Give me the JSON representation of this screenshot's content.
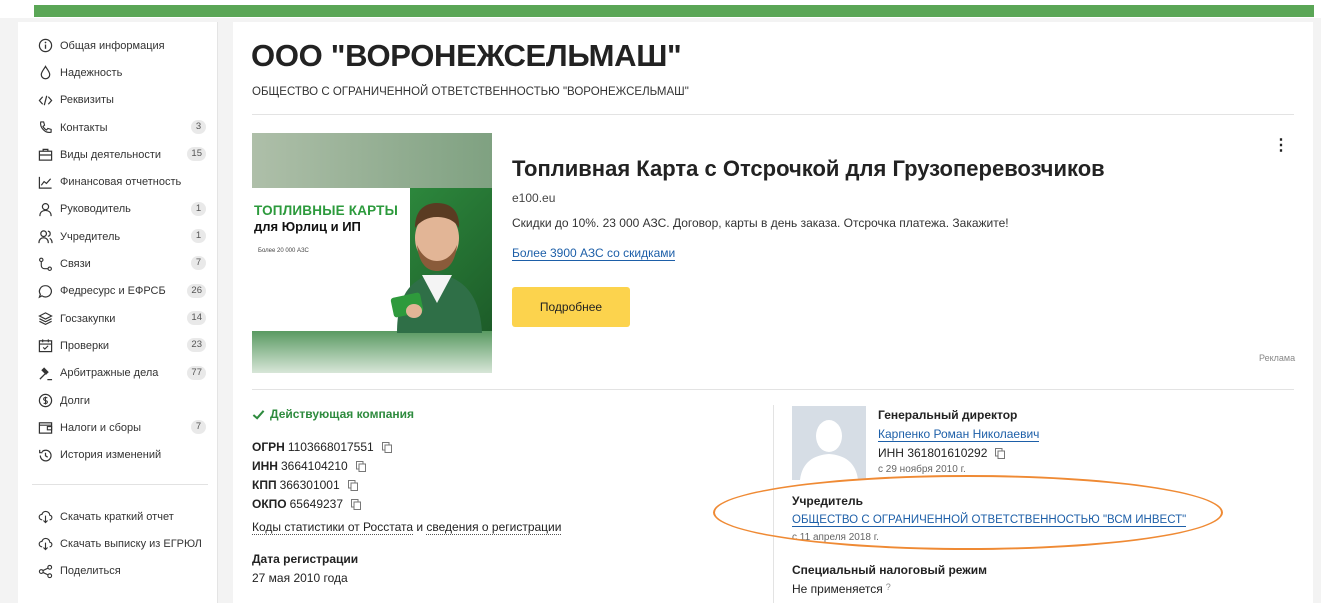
{
  "sidebar": {
    "items": [
      {
        "label": "Общая информация",
        "icon": "info-icon",
        "badge": ""
      },
      {
        "label": "Надежность",
        "icon": "drop-icon",
        "badge": ""
      },
      {
        "label": "Реквизиты",
        "icon": "code-icon",
        "badge": ""
      },
      {
        "label": "Контакты",
        "icon": "phone-icon",
        "badge": "3"
      },
      {
        "label": "Виды деятельности",
        "icon": "briefcase-icon",
        "badge": "15"
      },
      {
        "label": "Финансовая отчетность",
        "icon": "chart-icon",
        "badge": ""
      },
      {
        "label": "Руководитель",
        "icon": "person-icon",
        "badge": "1"
      },
      {
        "label": "Учредитель",
        "icon": "people-icon",
        "badge": "1"
      },
      {
        "label": "Связи",
        "icon": "links-icon",
        "badge": "7"
      },
      {
        "label": "Федресурс и ЕФРСБ",
        "icon": "chat-icon",
        "badge": "26"
      },
      {
        "label": "Госзакупки",
        "icon": "layers-icon",
        "badge": "14"
      },
      {
        "label": "Проверки",
        "icon": "calendar-icon",
        "badge": "23"
      },
      {
        "label": "Арбитражные дела",
        "icon": "gavel-icon",
        "badge": "77"
      },
      {
        "label": "Долги",
        "icon": "coin-icon",
        "badge": ""
      },
      {
        "label": "Налоги и сборы",
        "icon": "wallet-icon",
        "badge": "7"
      },
      {
        "label": "История изменений",
        "icon": "history-icon",
        "badge": ""
      }
    ],
    "actions": [
      {
        "label": "Скачать краткий отчет",
        "icon": "cloud-download-icon"
      },
      {
        "label": "Скачать выписку из ЕГРЮЛ",
        "icon": "cloud-download-icon"
      },
      {
        "label": "Поделиться",
        "icon": "share-icon"
      }
    ]
  },
  "company": {
    "title": "ООО \"ВОРОНЕЖСЕЛЬМАШ\"",
    "full_name": "ОБЩЕСТВО С ОГРАНИЧЕННОЙ ОТВЕТСТВЕННОСТЬЮ \"ВОРОНЕЖСЕЛЬМАШ\"",
    "status": "Действующая компания",
    "ogrn_label": "ОГРН",
    "ogrn": "1103668017551",
    "inn_label": "ИНН",
    "inn": "3664104210",
    "kpp_label": "КПП",
    "kpp": "366301001",
    "okpo_label": "ОКПО",
    "okpo": "65649237",
    "stats_link": "Коды статистики от Росстата",
    "stats_and": "и",
    "reg_info_link": "сведения о регистрации",
    "reg_date_label": "Дата регистрации",
    "reg_date": "27 мая 2010 года"
  },
  "ad": {
    "image_line1": "ТОПЛИВНЫЕ КАРТЫ",
    "image_line2": "для Юрлиц и ИП",
    "image_line3": "Более 20 000 АЗС",
    "title": "Топливная Карта с Отсрочкой для Грузоперевозчиков",
    "domain": "e100.eu",
    "text": "Скидки до 10%. 23 000 АЗС. Договор, карты в день заказа. Отсрочка платежа. Закажите!",
    "link": "Более 3900 АЗС со скидками",
    "button": "Подробнее",
    "more": "⋮",
    "label": "Реклама"
  },
  "director": {
    "role": "Генеральный директор",
    "name": "Карпенко Роман Николаевич",
    "inn_label": "ИНН",
    "inn": "361801610292",
    "since": "с 29 ноября 2010 г."
  },
  "founder": {
    "label": "Учредитель",
    "name": "ОБЩЕСТВО С ОГРАНИЧЕННОЙ ОТВЕТСТВЕННОСТЬЮ \"ВСМ ИНВЕСТ\"",
    "since": "с 11 апреля 2018 г."
  },
  "tax": {
    "label": "Специальный налоговый режим",
    "value": "Не применяется",
    "hint": "?"
  },
  "colors": {
    "accent_green": "#5aa656",
    "link_blue": "#1d5fa8",
    "button_yellow": "#fcd34d",
    "highlight_orange": "#ef8a34"
  }
}
